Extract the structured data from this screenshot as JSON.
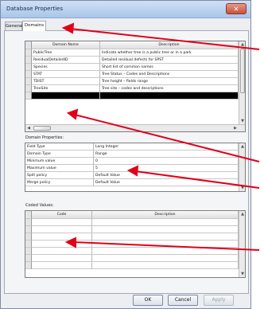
{
  "window": {
    "title": "Database Properties",
    "close_glyph": "✕"
  },
  "tabs": [
    {
      "label": "General"
    },
    {
      "label": "Domains"
    }
  ],
  "domains_table": {
    "headers": [
      "Domain Name",
      "Description"
    ],
    "rows": [
      [
        "PublicTree",
        "Indicate whether tree is a public tree or in a park"
      ],
      [
        "ResidualDetailedID",
        "Detailed residual defects for SPST"
      ],
      [
        "Species",
        "Short list of common names"
      ],
      [
        "STAT",
        "Tree Status – Codes and Descriptions"
      ],
      [
        "TDIST",
        "Tree height – fields range"
      ],
      [
        "TreeSite",
        "Tree site – codes and descriptions"
      ],
      [
        "",
        ""
      ]
    ]
  },
  "domain_properties": {
    "label": "Domain Properties:",
    "rows": [
      [
        "Field Type",
        "Long Integer"
      ],
      [
        "Domain Type",
        "Range"
      ],
      [
        "Minimum value",
        "0"
      ],
      [
        "Maximum value",
        "5"
      ],
      [
        "Split policy",
        "Default Value"
      ],
      [
        "Merge policy",
        "Default Value"
      ]
    ]
  },
  "coded_values": {
    "label": "Coded Values:",
    "headers": [
      "Code",
      "Description"
    ]
  },
  "buttons": {
    "ok": "OK",
    "cancel": "Cancel",
    "apply": "Apply"
  },
  "colors": {
    "annotation_arrow": "#e0001a",
    "selected_row": "#000000"
  }
}
